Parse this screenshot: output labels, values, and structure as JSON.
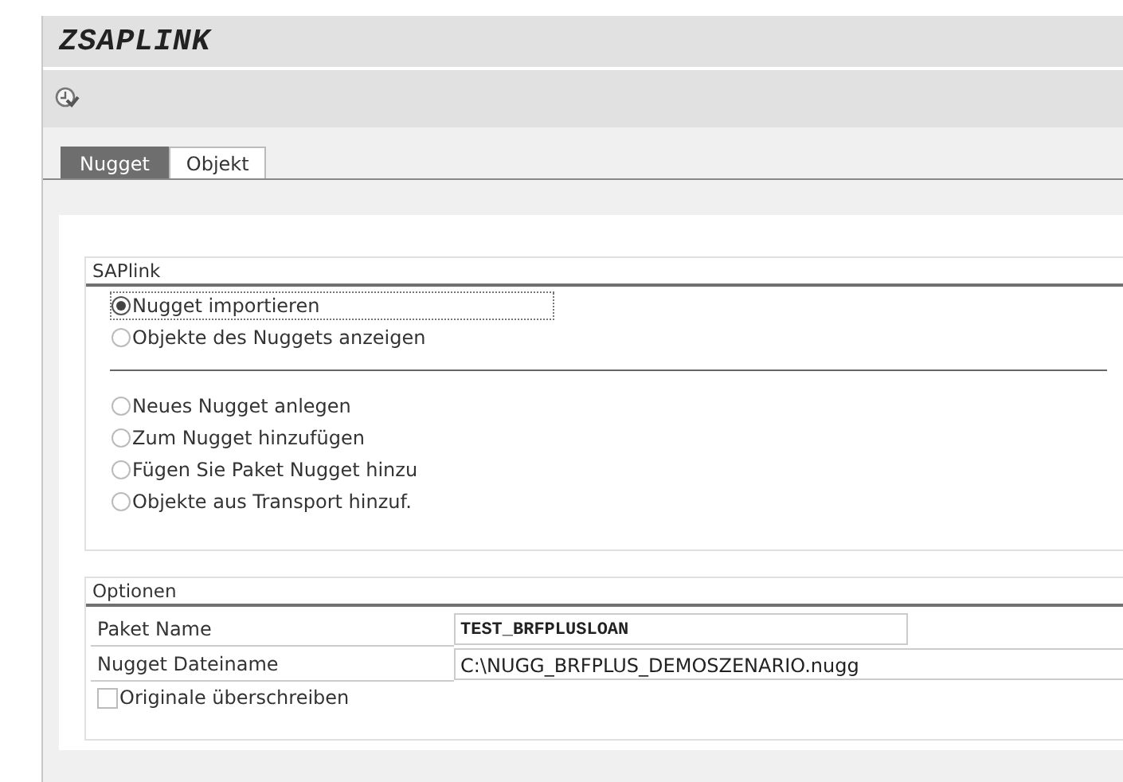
{
  "window": {
    "title": "ZSAPLINK"
  },
  "toolbar": {
    "buttons": [
      {
        "kind": "execute"
      }
    ]
  },
  "tabs": [
    {
      "label": "Nugget",
      "selected": true
    },
    {
      "label": "Objekt",
      "selected": false
    }
  ],
  "saplink": {
    "title": "SAPlink",
    "sections": [
      {
        "radios": [
          {
            "label": "Nugget importieren",
            "selected": true,
            "focused": true
          },
          {
            "label": "Objekte des Nuggets anzeigen",
            "selected": false,
            "focused": false
          }
        ]
      },
      {
        "radios": [
          {
            "label": "Neues Nugget anlegen",
            "selected": false,
            "focused": false
          },
          {
            "label": "Zum Nugget hinzufügen",
            "selected": false,
            "focused": false
          },
          {
            "label": "Fügen Sie Paket Nugget hinzu",
            "selected": false,
            "focused": false
          },
          {
            "label": "Objekte aus Transport hinzuf.",
            "selected": false,
            "focused": false
          }
        ]
      }
    ]
  },
  "optionen": {
    "title": "Optionen",
    "fields": [
      {
        "label": "Paket Name",
        "value": "TEST_BRFPLUSLOAN",
        "kind": "code"
      },
      {
        "label": "Nugget Dateiname",
        "value": "C:\\NUGG_BRFPLUS_DEMOSZENARIO.nugg",
        "kind": "text"
      }
    ],
    "checkboxes": [
      {
        "label": "Originale überschreiben",
        "checked": false
      }
    ]
  }
}
